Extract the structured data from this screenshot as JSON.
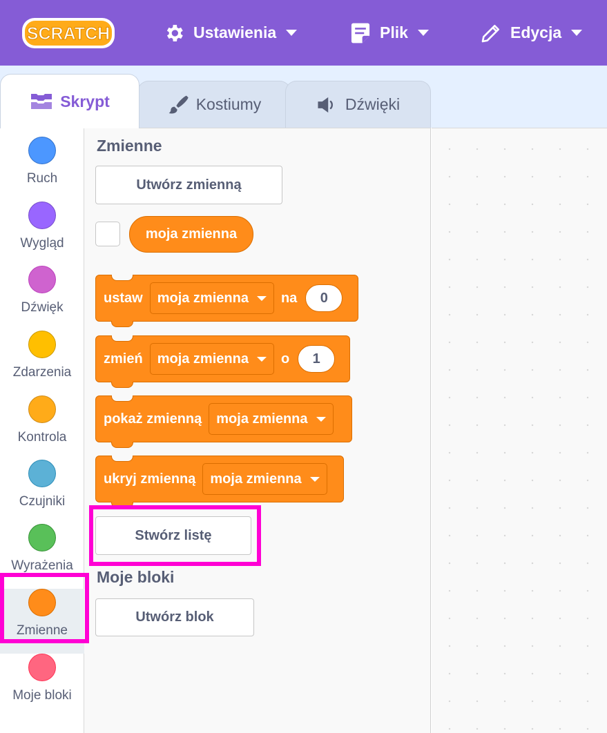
{
  "menubar": {
    "logo_text": "SCRATCH",
    "items": [
      {
        "label": "Ustawienia",
        "icon": "gear-icon"
      },
      {
        "label": "Plik",
        "icon": "file-icon"
      },
      {
        "label": "Edycja",
        "icon": "pencil-icon"
      }
    ],
    "background": "#855cd6"
  },
  "tabs": [
    {
      "label": "Skrypt",
      "icon": "code-blocks-icon",
      "active": true
    },
    {
      "label": "Kostiumy",
      "icon": "paintbrush-icon",
      "active": false
    },
    {
      "label": "Dźwięki",
      "icon": "speaker-icon",
      "active": false
    }
  ],
  "categories": [
    {
      "label": "Ruch",
      "color": "#4c97ff"
    },
    {
      "label": "Wygląd",
      "color": "#9966ff"
    },
    {
      "label": "Dźwięk",
      "color": "#cf63cf"
    },
    {
      "label": "Zdarzenia",
      "color": "#ffbf00"
    },
    {
      "label": "Kontrola",
      "color": "#ffab19"
    },
    {
      "label": "Czujniki",
      "color": "#5cb1d6"
    },
    {
      "label": "Wyrażenia",
      "color": "#59c059"
    },
    {
      "label": "Zmienne",
      "color": "#ff8c1a",
      "selected": true
    },
    {
      "label": "Moje bloki",
      "color": "#ff6680"
    }
  ],
  "palette": {
    "variables_heading": "Zmienne",
    "make_variable": "Utwórz zmienną",
    "variable_reporter": "moja zmienna",
    "blocks": {
      "set": {
        "label": "ustaw",
        "var": "moja zmienna",
        "joiner": "na",
        "value": "0"
      },
      "change": {
        "label": "zmień",
        "var": "moja zmienna",
        "joiner": "o",
        "value": "1"
      },
      "show": {
        "label": "pokaż zmienną",
        "var": "moja zmienna"
      },
      "hide": {
        "label": "ukryj zmienną",
        "var": "moja zmienna"
      }
    },
    "make_list": "Stwórz listę",
    "myblocks_heading": "Moje bloki",
    "make_block": "Utwórz blok"
  },
  "highlight_color": "#ff00d4"
}
